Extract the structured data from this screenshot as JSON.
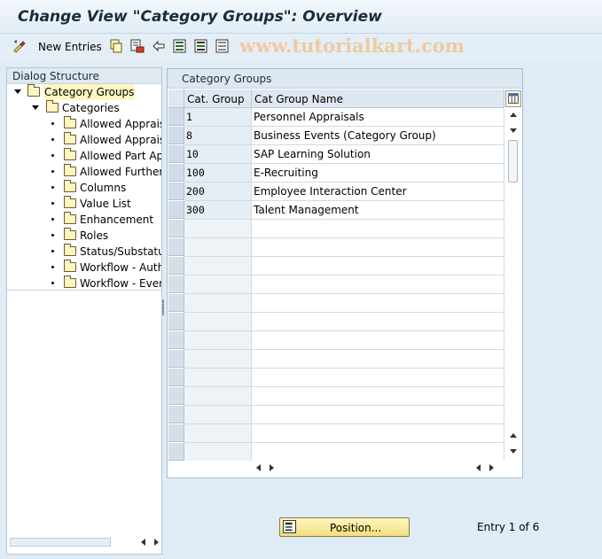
{
  "title": "Change View \"Category Groups\": Overview",
  "watermark": "www.tutorialkart.com",
  "toolbar": {
    "new_entries_label": "New Entries",
    "icons": [
      "edit-glasses-icon",
      "copy-icon",
      "delete-icon",
      "undo-icon",
      "select-all-icon",
      "select-block-icon",
      "deselect-all-icon"
    ]
  },
  "dialog_structure": {
    "header": "Dialog Structure",
    "items": [
      {
        "label": "Category Groups",
        "level": 0,
        "expanded": true,
        "selected": true
      },
      {
        "label": "Categories",
        "level": 1,
        "expanded": true,
        "selected": false
      },
      {
        "label": "Allowed Appraise",
        "level": 2
      },
      {
        "label": "Allowed Appraise",
        "level": 2
      },
      {
        "label": "Allowed Part App",
        "level": 2
      },
      {
        "label": "Allowed Further I",
        "level": 2
      },
      {
        "label": "Columns",
        "level": 2
      },
      {
        "label": "Value List",
        "level": 2
      },
      {
        "label": "Enhancement",
        "level": 2
      },
      {
        "label": "Roles",
        "level": 2
      },
      {
        "label": "Status/Substatus",
        "level": 2
      },
      {
        "label": "Workflow - Autho",
        "level": 2
      },
      {
        "label": "Workflow - Event",
        "level": 2
      }
    ]
  },
  "table": {
    "title": "Category Groups",
    "columns": [
      "Cat. Group",
      "Cat Group Name"
    ],
    "rows": [
      {
        "cat_group": "1",
        "name": "Personnel Appraisals"
      },
      {
        "cat_group": "8",
        "name": "Business Events (Category Group)"
      },
      {
        "cat_group": "10",
        "name": "SAP Learning Solution"
      },
      {
        "cat_group": "100",
        "name": "E-Recruiting"
      },
      {
        "cat_group": "200",
        "name": "Employee Interaction Center"
      },
      {
        "cat_group": "300",
        "name": "Talent Management"
      }
    ],
    "empty_rows": 13
  },
  "footer": {
    "position_button": "Position...",
    "entry_info": "Entry 1 of 6"
  },
  "colors": {
    "background": "#dfebf5",
    "selected_tree_item": "#fff6c2",
    "position_button": "#f4df7e"
  }
}
